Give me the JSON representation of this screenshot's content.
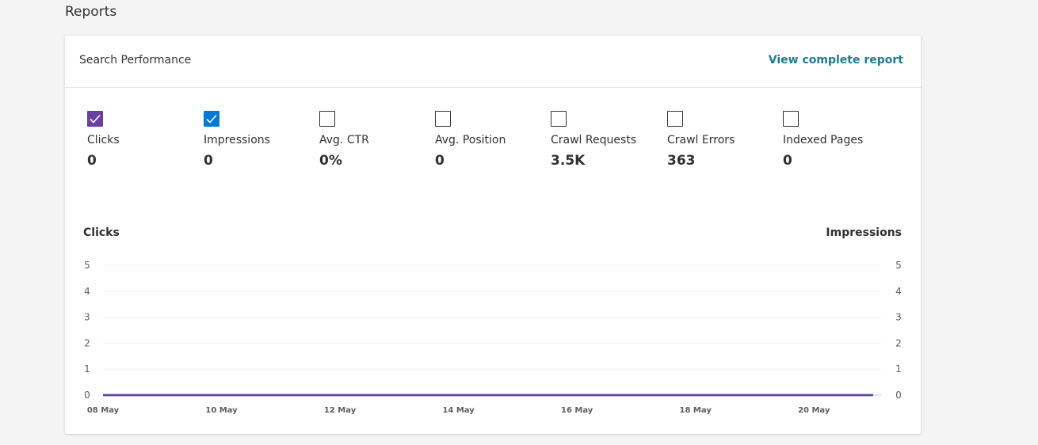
{
  "section": {
    "title": "Reports"
  },
  "card": {
    "title": "Search Performance",
    "view_link": "View complete report"
  },
  "metrics": [
    {
      "label": "Clicks",
      "value": "0",
      "checked": true,
      "color": "#6b3fa0"
    },
    {
      "label": "Impressions",
      "value": "0",
      "checked": true,
      "color": "#0078d4"
    },
    {
      "label": "Avg. CTR",
      "value": "0%",
      "checked": false
    },
    {
      "label": "Avg. Position",
      "value": "0",
      "checked": false
    },
    {
      "label": "Crawl Requests",
      "value": "3.5K",
      "checked": false
    },
    {
      "label": "Crawl Errors",
      "value": "363",
      "checked": false
    },
    {
      "label": "Indexed Pages",
      "value": "0",
      "checked": false
    }
  ],
  "chart_data": {
    "type": "line",
    "ylabel_left": "Clicks",
    "ylabel_right": "Impressions",
    "ylim": [
      0,
      5
    ],
    "y_ticks": [
      "0",
      "1",
      "2",
      "3",
      "4",
      "5"
    ],
    "x_ticks": [
      "08 May",
      "10 May",
      "12 May",
      "14 May",
      "16 May",
      "18 May",
      "20 May"
    ],
    "x_start": "08 May",
    "x_end": "21 May",
    "series": [
      {
        "name": "Clicks",
        "axis": "left",
        "color": "#6b3fa0",
        "values": [
          0,
          0,
          0,
          0,
          0,
          0,
          0,
          0,
          0,
          0,
          0,
          0,
          0,
          0
        ]
      },
      {
        "name": "Impressions",
        "axis": "right",
        "color": "#0078d4",
        "values": [
          0,
          0,
          0,
          0,
          0,
          0,
          0,
          0,
          0,
          0,
          0,
          0,
          0,
          0
        ]
      }
    ],
    "grid": true
  }
}
